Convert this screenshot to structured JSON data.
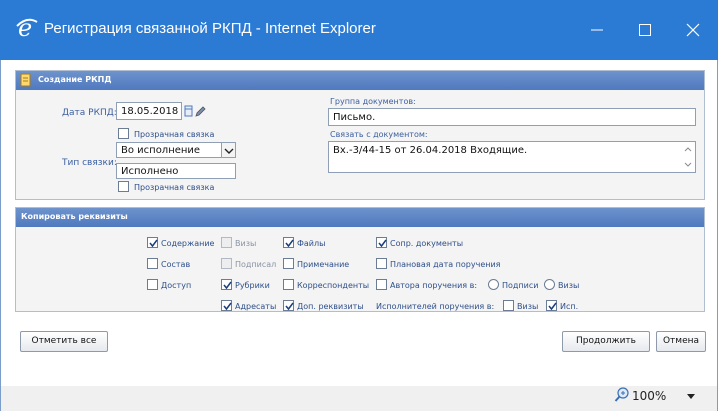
{
  "window": {
    "title": "Регистрация связанной РКПД - Internet Explorer"
  },
  "create_panel": {
    "header": "Создание РКПД",
    "date_label": "Дата РКПД:",
    "date_value": "18.05.2018",
    "transparent_link_1": "Прозрачная связка",
    "link_type_value": "Во исполнение",
    "link_type_label": "Тип связки:",
    "status_value": "Исполнено",
    "transparent_link_2": "Прозрачная связка",
    "doc_group_label": "Группа документов:",
    "doc_group_value": "Письмо.",
    "link_doc_label": "Связать с документом:",
    "link_doc_value": "Вх.-3/44-15 от 26.04.2018 Входящие."
  },
  "copy_panel": {
    "header": "Копировать реквизиты",
    "content": {
      "label": "Содержание",
      "checked": true
    },
    "visas": {
      "label": "Визы",
      "checked": false
    },
    "files": {
      "label": "Файлы",
      "checked": true
    },
    "accompanying": {
      "label": "Сопр. документы",
      "checked": true
    },
    "composition": {
      "label": "Состав",
      "checked": false
    },
    "signed": {
      "label": "Подписал",
      "checked": false
    },
    "note": {
      "label": "Примечание",
      "checked": false
    },
    "planned_date": {
      "label": "Плановая дата поручения",
      "checked": false
    },
    "access": {
      "label": "Доступ",
      "checked": false
    },
    "rubrics": {
      "label": "Рубрики",
      "checked": true
    },
    "correspondents": {
      "label": "Корреспонденты",
      "checked": false
    },
    "order_author": {
      "label": "Автора поручения в:",
      "checked": false
    },
    "radio_signatures": "Подписи",
    "radio_visas": "Визы",
    "addressees": {
      "label": "Адресаты",
      "checked": true
    },
    "extra_attributes": {
      "label": "Доп. реквизиты",
      "checked": true
    },
    "executors_label": "Исполнителей поручения в:",
    "executors_visas": {
      "label": "Визы",
      "checked": false
    },
    "executors_exec": {
      "label": "Исп.",
      "checked": true
    }
  },
  "buttons": {
    "mark_all": "Отметить все",
    "continue": "Продолжить",
    "cancel": "Отмена"
  },
  "statusbar": {
    "zoom": "100%"
  },
  "colors": {
    "titlebar": "#2b7ad3",
    "panel_header": "#5a82c4"
  }
}
